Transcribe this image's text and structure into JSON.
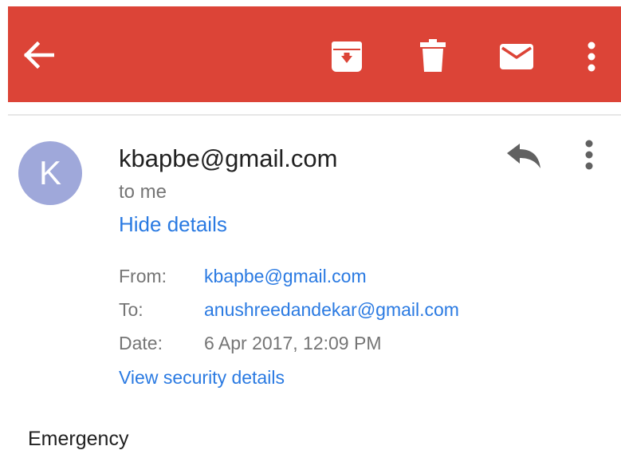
{
  "toolbar": {
    "color": "#dc4437",
    "icons": {
      "back": "arrow-back-icon",
      "archive": "archive-icon",
      "delete": "delete-icon",
      "mark_unread": "mail-icon",
      "more": "more-vert-icon"
    }
  },
  "message": {
    "avatar_letter": "K",
    "avatar_color": "#9fa8da",
    "sender": "kbapbe@gmail.com",
    "recipient_summary": "to me",
    "hide_details": "Hide details",
    "reply_icon": "reply-icon",
    "more_icon": "more-vert-icon",
    "details": {
      "from_label": "From:",
      "from_value": "kbapbe@gmail.com",
      "to_label": "To:",
      "to_value": "anushreedandekar@gmail.com",
      "date_label": "Date:",
      "date_value": "6 Apr 2017, 12:09 PM"
    },
    "security_link": "View security details",
    "body": "Emergency"
  }
}
